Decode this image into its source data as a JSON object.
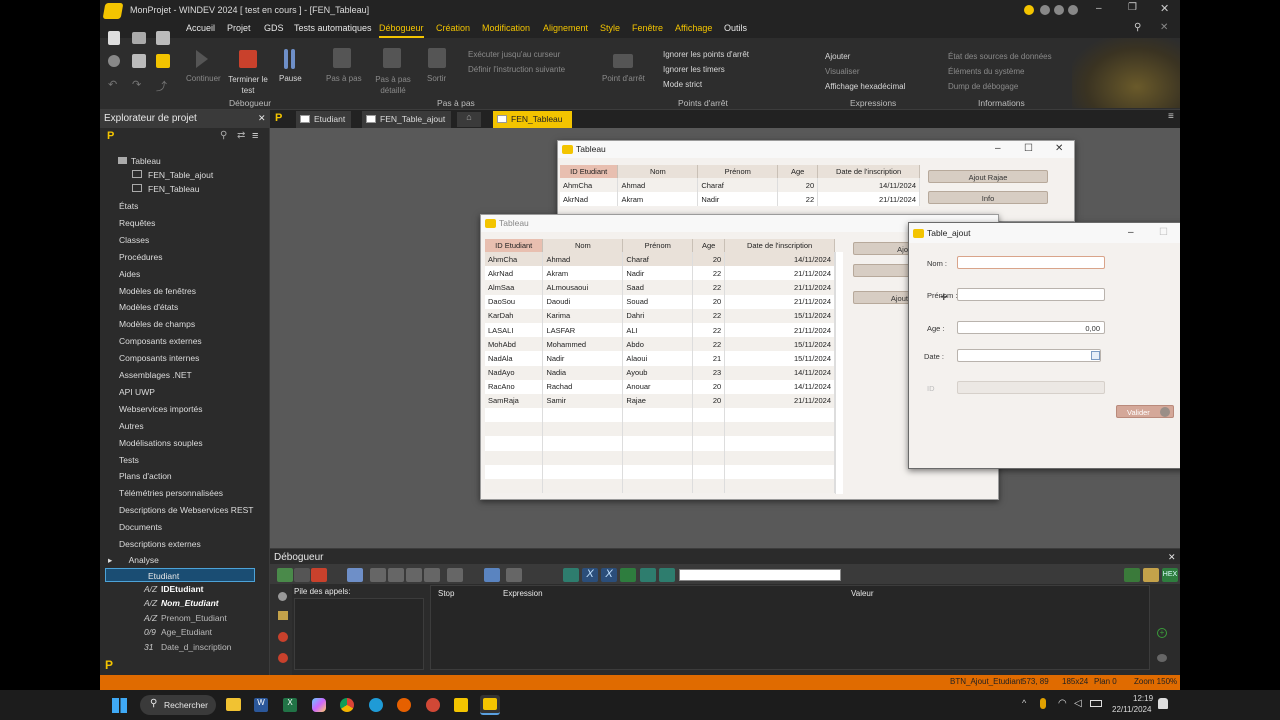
{
  "titlebar": {
    "title": "MonProjet - WINDEV 2024 [ test en cours ] - [FEN_Tableau]"
  },
  "menu": [
    "Accueil",
    "Projet",
    "GDS",
    "Tests automatiques",
    "Débogueur",
    "Création",
    "Modification",
    "Alignement",
    "Style",
    "Fenêtre",
    "Affichage",
    "Outils"
  ],
  "ribbon": {
    "continuer": "Continuer",
    "terminer": "Terminer le test",
    "pause": "Pause",
    "group_debogueur": "Débogueur",
    "pas_a_pas": "Pas à pas",
    "pas_a_pas_detaille": "Pas à pas détaillé",
    "sortir": "Sortir",
    "executer": "Exécuter jusqu'au curseur",
    "definir": "Définir l'instruction suivante",
    "group_pas": "Pas à pas",
    "point_arret": "Point d'arrêt",
    "ignorer_points": "Ignorer les points d'arrêt",
    "ignorer_timers": "Ignorer les timers",
    "mode_strict": "Mode strict",
    "group_points": "Points d'arrêt",
    "ajouter": "Ajouter",
    "visualiser": "Visualiser",
    "hexa": "Affichage hexadécimal",
    "group_expr": "Expressions",
    "etat_sources": "État des sources de données",
    "elements_systeme": "Éléments du système",
    "dump": "Dump de débogage",
    "group_info": "Informations"
  },
  "tabs": [
    "Etudiant",
    "FEN_Table_ajout",
    "FEN_Tableau"
  ],
  "sidebar": {
    "title": "Explorateur de projet",
    "tree_top": [
      "Tableau",
      "FEN_Table_ajout",
      "FEN_Tableau"
    ],
    "items": [
      "États",
      "Requêtes",
      "Classes",
      "Procédures",
      "Aides",
      "Modèles de fenêtres",
      "Modèles d'états",
      "Modèles de champs",
      "Composants externes",
      "Composants internes",
      "Assemblages .NET",
      "API UWP",
      "Webservices importés",
      "Autres",
      "Modélisations souples",
      "Tests",
      "Plans d'action",
      "Télémétries personnalisées",
      "Descriptions de Webservices REST",
      "Documents",
      "Descriptions externes"
    ],
    "analyse": "Analyse",
    "etudiant": "Etudiant",
    "fields": [
      {
        "type": "A/Z",
        "name": "IDEtudiant"
      },
      {
        "type": "A/Z",
        "name": "Nom_Etudiant"
      },
      {
        "type": "A/Z",
        "name": "Prenom_Etudiant"
      },
      {
        "type": "0/9",
        "name": "Age_Etudiant"
      },
      {
        "type": "31",
        "name": "Date_d_inscription"
      }
    ]
  },
  "win_back": {
    "title": "Tableau",
    "columns": [
      "ID Etudiant",
      "Nom",
      "Prénom",
      "Age",
      "Date de l'inscription"
    ],
    "rows": [
      [
        "AhmCha",
        "Ahmad",
        "Charaf",
        "20",
        "14/11/2024"
      ],
      [
        "AkrNad",
        "Akram",
        "Nadir",
        "22",
        "21/11/2024"
      ]
    ],
    "btn_ajout": "Ajout Rajae",
    "btn_info": "Info"
  },
  "win_main": {
    "title": "Tableau",
    "columns": [
      "ID Etudiant",
      "Nom",
      "Prénom",
      "Age",
      "Date de l'inscription"
    ],
    "rows": [
      [
        "AhmCha",
        "Ahmad",
        "Charaf",
        "20",
        "14/11/2024"
      ],
      [
        "AkrNad",
        "Akram",
        "Nadir",
        "22",
        "21/11/2024"
      ],
      [
        "AlmSaa",
        "ALmousaoui",
        "Saad",
        "22",
        "21/11/2024"
      ],
      [
        "DaoSou",
        "Daoudi",
        "Souad",
        "20",
        "21/11/2024"
      ],
      [
        "KarDah",
        "Karima",
        "Dahri",
        "22",
        "15/11/2024"
      ],
      [
        "LASALI",
        "LASFAR",
        "ALI",
        "22",
        "21/11/2024"
      ],
      [
        "MohAbd",
        "Mohammed",
        "Abdo",
        "22",
        "15/11/2024"
      ],
      [
        "NadAla",
        "Nadir",
        "Alaoui",
        "21",
        "15/11/2024"
      ],
      [
        "NadAyo",
        "Nadia",
        "Ayoub",
        "23",
        "14/11/2024"
      ],
      [
        "RacAno",
        "Rachad",
        "Anouar",
        "20",
        "14/11/2024"
      ],
      [
        "SamRaja",
        "Samir",
        "Rajae",
        "20",
        "21/11/2024"
      ]
    ],
    "btn1": "Ajo",
    "btn3": "Ajout"
  },
  "form": {
    "title": "Table_ajout",
    "nom_label": "Nom :",
    "prenom_label": "Prénom :",
    "age_label": "Age :",
    "date_label": "Date :",
    "id_label": "ID",
    "age_value": "0,00",
    "valider": "Valider"
  },
  "debugger": {
    "title": "Débogueur",
    "pile": "Pile des appels:",
    "col_stop": "Stop",
    "col_expr": "Expression",
    "col_valeur": "Valeur"
  },
  "status": {
    "control": "BTN_Ajout_Etudiant",
    "pos": "573, 89",
    "size": "185x24",
    "plan": "Plan 0",
    "zoom": "Zoom 150%"
  },
  "taskbar": {
    "search": "Rechercher",
    "time": "12:19",
    "date": "22/11/2024"
  },
  "colors": {
    "accent": "#f3c400",
    "status": "#e06b00",
    "active_menu": "#f3c400"
  }
}
